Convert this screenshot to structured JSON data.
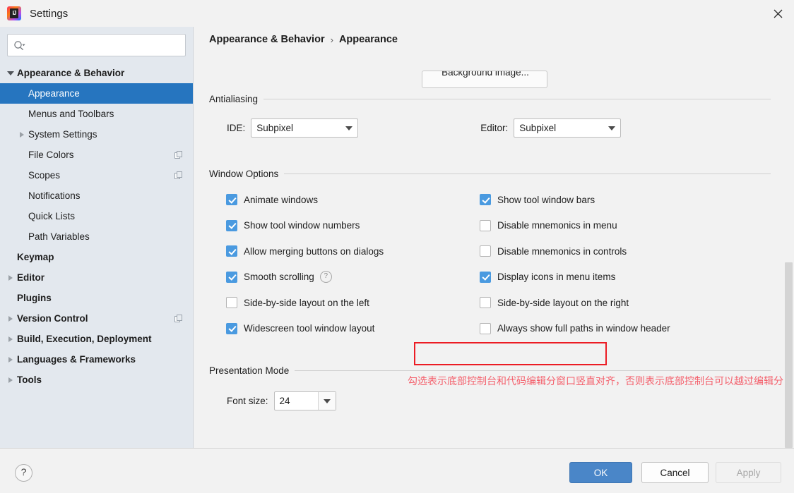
{
  "window": {
    "title": "Settings",
    "logo_text": "IJ",
    "close_icon": "close-icon"
  },
  "sidebar": {
    "search": {
      "value": "",
      "placeholder": ""
    },
    "items": [
      {
        "label": "Appearance & Behavior",
        "indent": 0,
        "bold": true,
        "arrow": "down",
        "selected": false,
        "badge": false
      },
      {
        "label": "Appearance",
        "indent": 1,
        "bold": false,
        "arrow": "none",
        "selected": true,
        "badge": false
      },
      {
        "label": "Menus and Toolbars",
        "indent": 1,
        "bold": false,
        "arrow": "none",
        "selected": false,
        "badge": false
      },
      {
        "label": "System Settings",
        "indent": 1,
        "bold": false,
        "arrow": "right",
        "selected": false,
        "badge": false
      },
      {
        "label": "File Colors",
        "indent": 1,
        "bold": false,
        "arrow": "none",
        "selected": false,
        "badge": true
      },
      {
        "label": "Scopes",
        "indent": 1,
        "bold": false,
        "arrow": "none",
        "selected": false,
        "badge": true
      },
      {
        "label": "Notifications",
        "indent": 1,
        "bold": false,
        "arrow": "none",
        "selected": false,
        "badge": false
      },
      {
        "label": "Quick Lists",
        "indent": 1,
        "bold": false,
        "arrow": "none",
        "selected": false,
        "badge": false
      },
      {
        "label": "Path Variables",
        "indent": 1,
        "bold": false,
        "arrow": "none",
        "selected": false,
        "badge": false
      },
      {
        "label": "Keymap",
        "indent": 0,
        "bold": true,
        "arrow": "none",
        "selected": false,
        "badge": false
      },
      {
        "label": "Editor",
        "indent": 0,
        "bold": true,
        "arrow": "right",
        "selected": false,
        "badge": false
      },
      {
        "label": "Plugins",
        "indent": 0,
        "bold": true,
        "arrow": "none",
        "selected": false,
        "badge": false
      },
      {
        "label": "Version Control",
        "indent": 0,
        "bold": true,
        "arrow": "right",
        "selected": false,
        "badge": true
      },
      {
        "label": "Build, Execution, Deployment",
        "indent": 0,
        "bold": true,
        "arrow": "right",
        "selected": false,
        "badge": false
      },
      {
        "label": "Languages & Frameworks",
        "indent": 0,
        "bold": true,
        "arrow": "right",
        "selected": false,
        "badge": false
      },
      {
        "label": "Tools",
        "indent": 0,
        "bold": true,
        "arrow": "right",
        "selected": false,
        "badge": false
      }
    ]
  },
  "main": {
    "breadcrumb": {
      "root": "Appearance & Behavior",
      "separator": "›",
      "leaf": "Appearance"
    },
    "background_image_button": "Background image...",
    "antialiasing": {
      "title": "Antialiasing",
      "ide_label": "IDE:",
      "ide_value": "Subpixel",
      "editor_label": "Editor:",
      "editor_value": "Subpixel"
    },
    "window_options": {
      "title": "Window Options",
      "left": [
        {
          "label": "Animate windows",
          "checked": true,
          "help": false
        },
        {
          "label": "Show tool window numbers",
          "checked": true,
          "help": false
        },
        {
          "label": "Allow merging buttons on dialogs",
          "checked": true,
          "help": false
        },
        {
          "label": "Smooth scrolling",
          "checked": true,
          "help": true
        },
        {
          "label": "Side-by-side layout on the left",
          "checked": false,
          "help": false
        },
        {
          "label": "Widescreen tool window layout",
          "checked": true,
          "help": false
        }
      ],
      "right": [
        {
          "label": "Show tool window bars",
          "checked": true,
          "help": false
        },
        {
          "label": "Disable mnemonics in menu",
          "checked": false,
          "help": false
        },
        {
          "label": "Disable mnemonics in controls",
          "checked": false,
          "help": false
        },
        {
          "label": "Display icons in menu items",
          "checked": true,
          "help": false
        },
        {
          "label": "Side-by-side layout on the right",
          "checked": false,
          "help": false
        },
        {
          "label": "Always show full paths in window header",
          "checked": false,
          "help": false
        }
      ]
    },
    "annotation": "勾选表示底部控制台和代码编辑分窗口竖直对齐，否则表示底部控制台可以越过编辑分窗口占位Project项目视图",
    "presentation_mode": {
      "title": "Presentation Mode",
      "font_size_label": "Font size:",
      "font_size_value": "24"
    }
  },
  "footer": {
    "help_label": "?",
    "ok": "OK",
    "cancel": "Cancel",
    "apply": "Apply"
  },
  "colors": {
    "accent": "#2675bf",
    "checkbox_on": "#4a9ae0",
    "highlight": "#ec1c24",
    "annotation": "#f4606c",
    "sidebar_bg": "#e3e8ee",
    "content_bg": "#f2f2f2"
  }
}
